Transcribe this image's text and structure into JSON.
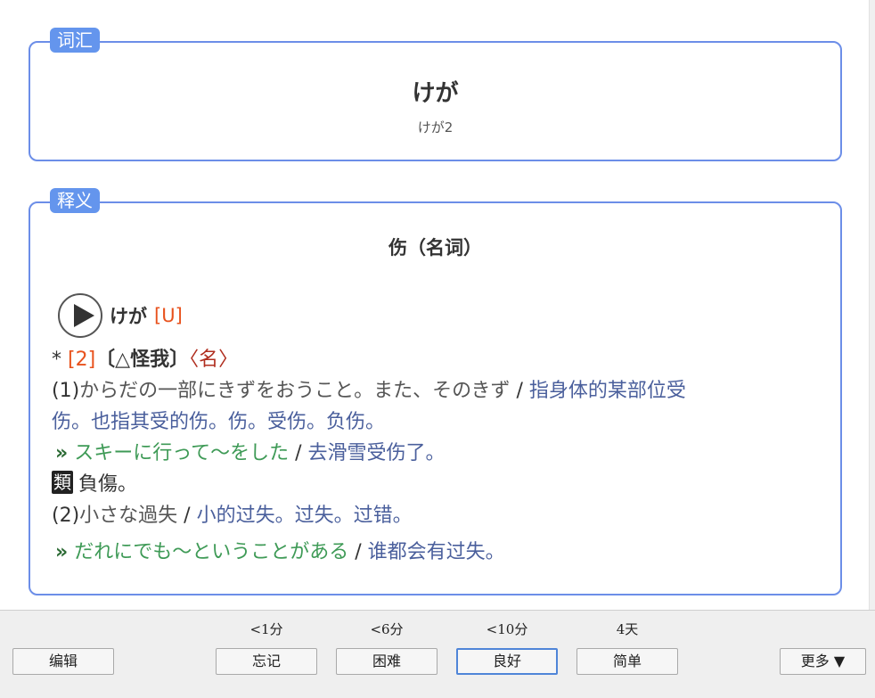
{
  "vocab": {
    "tag": "词汇",
    "word": "けが",
    "reading": "けが2"
  },
  "definition": {
    "tag": "释义",
    "title": "伤（名词）",
    "head_kana": "けが",
    "head_tag": "[U]",
    "line1": {
      "star": "* ",
      "num": "[2]",
      "kanji": "〔△怪我〕",
      "pos": "〈名〉"
    },
    "sense1": {
      "label": "(1)",
      "jp": "からだの一部にきずをおうこと。また、そのきず",
      "sep": " / ",
      "cn_line1": "指身体的某部位受",
      "cn_line2": "伤。也指其受的伤。伤。受伤。负伤。"
    },
    "example1": {
      "mark": "»",
      "jp": "スキーに行って～をした",
      "sep": " / ",
      "cn": "去滑雪受伤了。"
    },
    "synonym": {
      "badge": "類",
      "text": "負傷。"
    },
    "sense2": {
      "label": "(2)",
      "jp": "小さな過失",
      "sep": " / ",
      "cn": "小的过失。过失。过错。"
    },
    "example2": {
      "mark": "»",
      "jp": "だれにでも～ということがある",
      "sep": " / ",
      "cn": "谁都会有过失。"
    }
  },
  "bottom": {
    "edit_label": "编辑",
    "more_label": "更多 ▼",
    "answers": [
      {
        "time": "<1分",
        "label": "忘记"
      },
      {
        "time": "<6分",
        "label": "困难"
      },
      {
        "time": "<10分",
        "label": "良好"
      },
      {
        "time": "4天",
        "label": "简单"
      }
    ]
  },
  "colors": {
    "accent": "#6495ed",
    "border": "#6c8ee8",
    "tag_orange": "#e8521d",
    "example_green": "#3e9a56",
    "meaning_blue": "#4a5f9c"
  }
}
